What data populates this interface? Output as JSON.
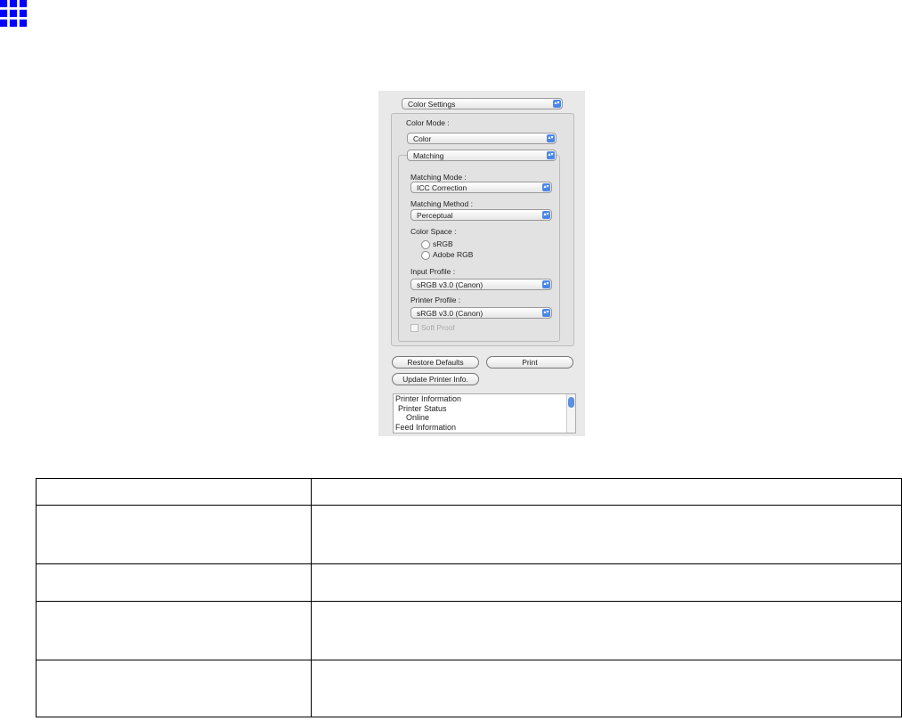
{
  "panel": {
    "section_select": "Color Settings",
    "color_mode_label": "Color Mode :",
    "color_mode": "Color",
    "group_select": "Matching",
    "matching_mode_label": "Matching Mode :",
    "matching_mode": "ICC Correction",
    "matching_method_label": "Matching Method :",
    "matching_method": "Perceptual",
    "color_space_label": "Color Space :",
    "color_space_options": [
      "sRGB",
      "Adobe RGB"
    ],
    "input_profile_label": "Input Profile :",
    "input_profile": "sRGB v3.0 (Canon)",
    "printer_profile_label": "Printer Profile :",
    "printer_profile": "sRGB v3.0 (Canon)",
    "soft_proof": "Soft Proof",
    "restore_defaults": "Restore Defaults",
    "print": "Print",
    "update_printer_info": "Update Printer Info.",
    "info_lines": [
      "Printer Information",
      "Printer Status",
      "Online",
      "Feed Information"
    ]
  },
  "table": {
    "rows": [
      [
        "",
        ""
      ],
      [
        "",
        ""
      ],
      [
        "",
        ""
      ],
      [
        "",
        ""
      ],
      [
        "",
        ""
      ]
    ]
  }
}
